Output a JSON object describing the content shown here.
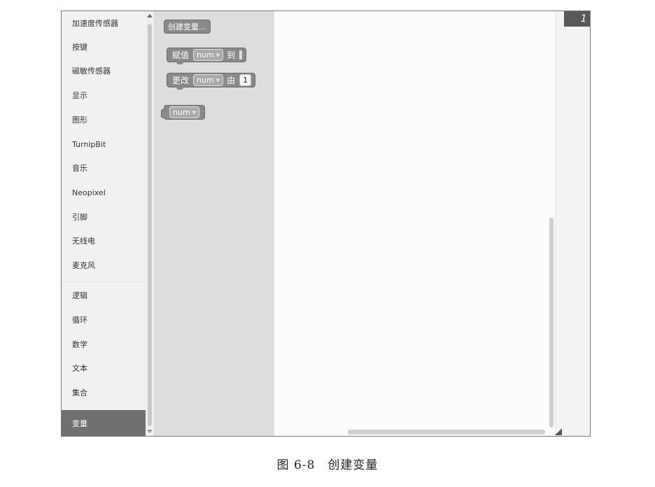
{
  "categories": [
    {
      "label": "加速度传感器",
      "active": false
    },
    {
      "label": "按键",
      "active": false
    },
    {
      "label": "磁敏传感器",
      "active": false
    },
    {
      "label": "显示",
      "active": false
    },
    {
      "label": "图形",
      "active": false
    },
    {
      "label": "TurnipBit",
      "active": false
    },
    {
      "label": "音乐",
      "active": false
    },
    {
      "label": "Neopixel",
      "active": false
    },
    {
      "label": "引脚",
      "active": false
    },
    {
      "label": "无线电",
      "active": false
    },
    {
      "label": "麦克风",
      "active": false
    },
    {
      "label": "逻辑",
      "active": false
    },
    {
      "label": "循环",
      "active": false
    },
    {
      "label": "数学",
      "active": false
    },
    {
      "label": "文本",
      "active": false
    },
    {
      "label": "集合",
      "active": false
    },
    {
      "label": "变量",
      "active": true
    }
  ],
  "flyout": {
    "create_button": "创建变量...",
    "set_block": {
      "prefix": "赋值",
      "var": "num",
      "suffix": "到"
    },
    "change_block": {
      "prefix": "更改",
      "var": "num",
      "middle": "由",
      "value": "1"
    },
    "get_block": {
      "var": "num"
    }
  },
  "workspace": {
    "line_number": "1"
  },
  "icons": {
    "trash": "trash-icon",
    "dropdown": "dropdown-arrow-icon"
  },
  "caption": "图 6-8　创建变量"
}
